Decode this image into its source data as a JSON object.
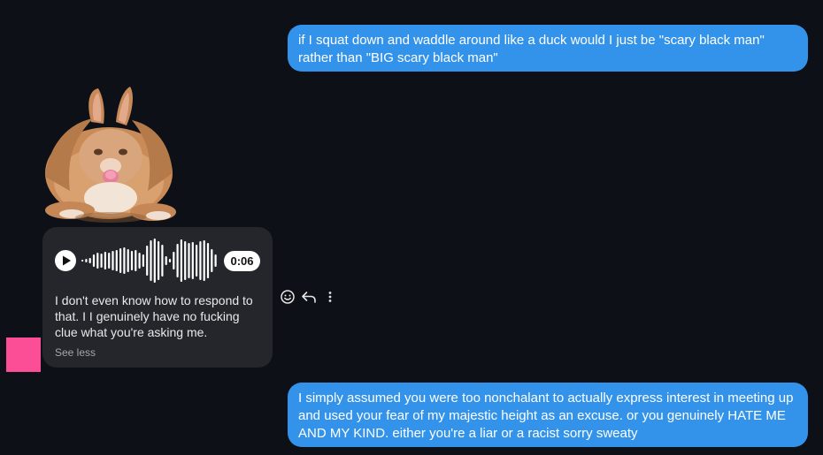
{
  "conversation": {
    "messages": [
      {
        "direction": "outgoing",
        "text": "if I squat down and waddle around like a duck would I just be \"scary black man\" rather than \"BIG scary black man\""
      },
      {
        "direction": "incoming",
        "type": "sticker",
        "sticker": "orange-bunny-cat-sticker"
      },
      {
        "direction": "incoming",
        "type": "voice",
        "duration": "0:06",
        "transcript": "I don't even know how to respond to that. I I genuinely have no fucking clue what you're asking me.",
        "toggle_label": "See less"
      },
      {
        "direction": "outgoing",
        "text": "I simply assumed you were too nonchalant to actually express interest in meeting up and used your fear of my majestic height as an excuse. or you genuinely HATE ME AND MY KIND. either you're a liar or a racist sorry sweaty"
      }
    ]
  },
  "message_actions": {
    "icons": [
      "smiley-icon",
      "reply-icon",
      "more-vertical-icon"
    ]
  },
  "colors": {
    "background": "#0d1016",
    "outgoing_bubble": "#3393ea",
    "incoming_bubble": "#24262c",
    "avatar": "#fb4e96"
  }
}
